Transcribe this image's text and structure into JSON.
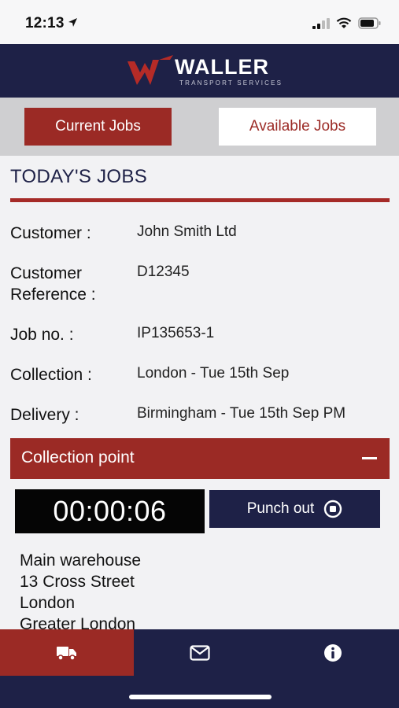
{
  "status_bar": {
    "time": "12:13"
  },
  "brand": {
    "name": "WALLER",
    "tagline": "TRANSPORT SERVICES",
    "accent": "#9b2a25",
    "navy": "#1e2147"
  },
  "tabs": [
    {
      "label": "Current Jobs",
      "active": true
    },
    {
      "label": "Available Jobs",
      "active": false
    }
  ],
  "section_title": "TODAY'S JOBS",
  "job": {
    "customer": {
      "label": "Customer :",
      "value": "John Smith Ltd"
    },
    "reference": {
      "label_line1": "Customer",
      "label_line2": "Reference :",
      "value": "D12345"
    },
    "job_no": {
      "label": "Job no. :",
      "value": "IP135653-1"
    },
    "collection": {
      "label": "Collection :",
      "value": "London - Tue 15th Sep"
    },
    "delivery": {
      "label": "Delivery :",
      "value": "Birmingham - Tue 15th Sep PM"
    }
  },
  "collection_point": {
    "title": "Collection point",
    "timer": "00:00:06",
    "punch_label": "Punch out",
    "address": [
      "Main warehouse",
      "13 Cross Street",
      "London",
      "Greater London"
    ]
  },
  "bottom_nav": [
    {
      "icon": "truck-icon",
      "active": true
    },
    {
      "icon": "envelope-icon",
      "active": false
    },
    {
      "icon": "info-icon",
      "active": false
    }
  ]
}
